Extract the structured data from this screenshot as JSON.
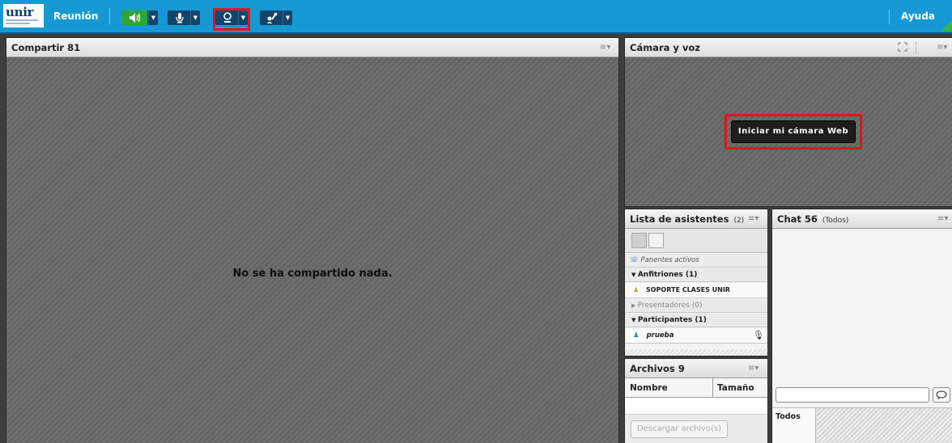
{
  "topbar": {
    "logo_text": "unir",
    "menu_reunion": "Reunión",
    "help": "Ayuda",
    "colors": {
      "bar": "#1699d3",
      "speaker_active": "#2ea53a",
      "highlight": "#e3141d"
    },
    "icons": [
      "speaker-icon",
      "microphone-icon",
      "webcam-icon",
      "raise-hand-icon"
    ]
  },
  "share_pod": {
    "title": "Compartir 81",
    "empty_message": "No se ha compartido nada."
  },
  "camera_pod": {
    "title": "Cámara y voz",
    "start_button": "Iniciar mi cámara Web"
  },
  "attendees_pod": {
    "title": "Lista de asistentes",
    "count": "(2)",
    "active_speakers": "Panentes activos",
    "hosts_group": "Anfitriones (1)",
    "host_user": "SOPORTE CLASES UNIR",
    "presenters_group": "Presentadores (0)",
    "participants_group": "Participantes (1)",
    "participant_user": "prueba"
  },
  "files_pod": {
    "title": "Archivos 9",
    "col_name": "Nombre",
    "col_size": "Tamaño",
    "download_button": "Descargar archivo(s)"
  },
  "chat_pod": {
    "title": "Chat 56",
    "scope": "(Todos)",
    "input_value": "",
    "tab_all": "Todos"
  }
}
